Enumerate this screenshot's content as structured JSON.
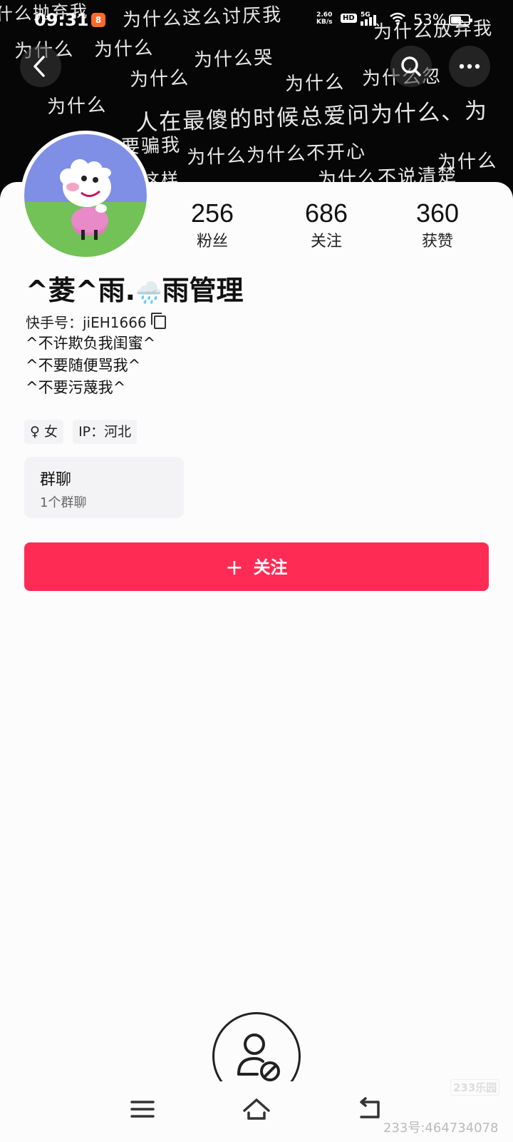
{
  "status_bar": {
    "time": "09:31",
    "app_icon": "kuaishou-icon",
    "net_speed_value": "2.60",
    "net_speed_unit": "KB/s",
    "hd": "HD",
    "network": "5G",
    "battery": "53%"
  },
  "banner": {
    "lines": [
      "什么抛弃我",
      "为什么这么讨厌我",
      "为什么放弃我",
      "为什么",
      "为什么",
      "为什么哭",
      "为什么",
      "为什么",
      "为什么忽",
      "为什么",
      "人在最傻的时候总爱问为什么、为",
      "要骗我",
      "为什么为什么不开心",
      "为什么",
      "这样",
      "为什么不说清楚"
    ]
  },
  "stats": [
    {
      "value": "256",
      "label": "粉丝"
    },
    {
      "value": "686",
      "label": "关注"
    },
    {
      "value": "360",
      "label": "获赞"
    }
  ],
  "profile": {
    "name_prefix": "^菱^雨.",
    "name_emoji": "🌧️",
    "name_suffix": "雨管理",
    "uid": "快手号：jiEH1666",
    "bio": [
      "^不许欺负我闺蜜^",
      "^不要随便骂我^",
      "^不要污蔑我^"
    ],
    "gender_tag": "♀ 女",
    "ip_tag": "IP：河北"
  },
  "group": {
    "title": "群聊",
    "subtitle": "1个群聊"
  },
  "follow_button": {
    "plus": "+",
    "label": "关注"
  },
  "watermarks": {
    "site": "233乐园",
    "account": "233号:464734078"
  },
  "colors": {
    "accent": "#fe2c55",
    "banner_bg": "#060606"
  }
}
